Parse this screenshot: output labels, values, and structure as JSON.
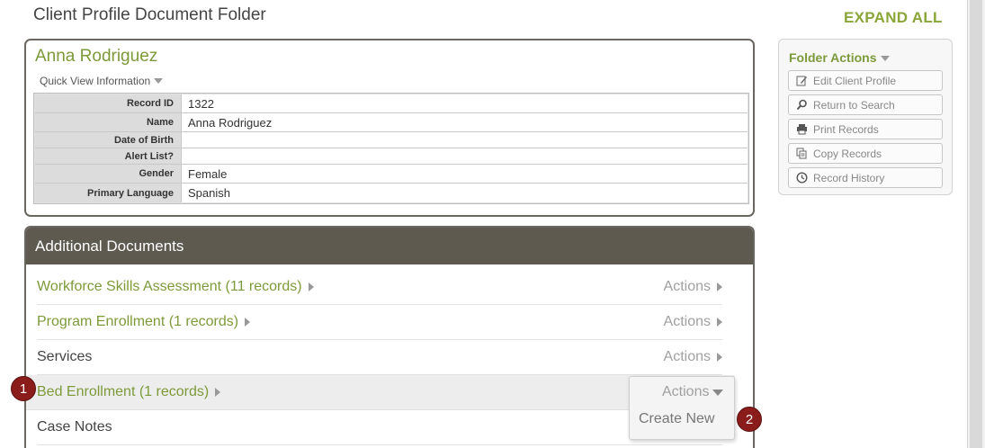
{
  "page": {
    "title": "Client Profile Document Folder",
    "expand_all": "EXPAND ALL"
  },
  "profile": {
    "name": "Anna Rodriguez",
    "quick_view": "Quick View Information",
    "fields": [
      {
        "label": "Record ID",
        "value": "1322"
      },
      {
        "label": "Name",
        "value": "Anna Rodriguez"
      },
      {
        "label": "Date of Birth",
        "value": ""
      },
      {
        "label": "Alert List?",
        "value": ""
      },
      {
        "label": "Gender",
        "value": "Female"
      },
      {
        "label": "Primary Language",
        "value": "Spanish"
      }
    ]
  },
  "documents": {
    "header": "Additional Documents",
    "rows": [
      {
        "label": "Workforce Skills Assessment (11 records)",
        "actions": "Actions"
      },
      {
        "label": "Program Enrollment (1 records)",
        "actions": "Actions"
      },
      {
        "label": "Services",
        "actions": "Actions"
      },
      {
        "label": "Bed Enrollment (1 records)",
        "actions": "Actions"
      },
      {
        "label": "Case Notes"
      }
    ],
    "dropdown": {
      "head": "Actions",
      "item": "Create New"
    }
  },
  "badges": [
    "1",
    "2"
  ],
  "folder_actions": {
    "title": "Folder Actions",
    "buttons": [
      {
        "label": "Edit Client Profile",
        "icon": "edit-icon"
      },
      {
        "label": "Return to Search",
        "icon": "search-icon"
      },
      {
        "label": "Print Records",
        "icon": "printer-icon"
      },
      {
        "label": "Copy Records",
        "icon": "copy-icon"
      },
      {
        "label": "Record History",
        "icon": "clock-icon"
      }
    ]
  },
  "colors": {
    "accent": "#7d9a3a",
    "header_bg": "#5e5a4f",
    "badge": "#8a1c1c"
  }
}
